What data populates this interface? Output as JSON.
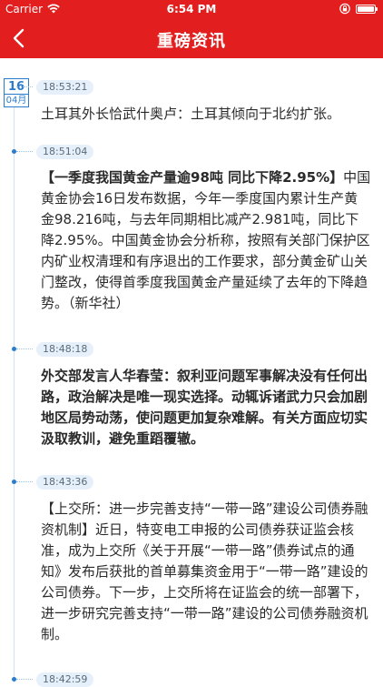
{
  "status_bar": {
    "carrier": "Carrier",
    "time": "6:54 PM"
  },
  "nav": {
    "title": "重磅资讯"
  },
  "date_badge": {
    "day": "16",
    "month": "04月"
  },
  "items": [
    {
      "time": "18:53:21",
      "text": "土耳其外长恰武什奥卢：土耳其倾向于北约扩张。",
      "bold": false
    },
    {
      "time": "18:51:04",
      "headline": "【一季度我国黄金产量逾98吨 同比下降2.95%】",
      "text": "中国黄金协会16日发布数据，今年一季度国内累计生产黄金98.216吨，与去年同期相比减产2.981吨，同比下降2.95%。中国黄金协会分析称，按照有关部门保护区内矿业权清理和有序退出的工作要求，部分黄金矿山关门整改，使得首季度我国黄金产量延续了去年的下降趋势。（新华社）",
      "bold": false
    },
    {
      "time": "18:48:18",
      "text": "外交部发言人华春莹：叙利亚问题军事解决没有任何出路，政治解决是唯一现实选择。动辄诉诸武力只会加剧地区局势动荡，使问题更加复杂难解。有关方面应切实汲取教训，避免重蹈覆辙。",
      "bold": true
    },
    {
      "time": "18:43:36",
      "text": "【上交所：进一步完善支持“一带一路”建设公司债券融资机制】近日，特变电工申报的公司债券获证监会核准，成为上交所《关于开展“一带一路”债券试点的通知》发布后获批的首单募集资金用于“一带一路”建设的公司债券。下一步，上交所将在证监会的统一部署下，进一步研究完善支持“一带一路”建设的公司债券融资机制。",
      "bold": false
    },
    {
      "time": "18:42:59"
    }
  ]
}
